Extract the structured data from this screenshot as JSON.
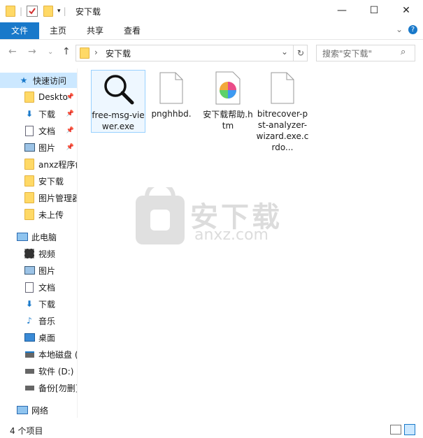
{
  "window": {
    "title": "安下载",
    "controls": {
      "minimize": "—",
      "maximize": "☐",
      "close": "✕"
    }
  },
  "ribbon": {
    "tabs": [
      "文件",
      "主页",
      "共享",
      "查看"
    ],
    "expand_glyph": "⌄",
    "help_glyph": "?"
  },
  "navbar": {
    "back": "←",
    "forward": "→",
    "recent": "⌄",
    "up": "↑",
    "address_sep": "›",
    "address": "安下载",
    "dropdown": "⌄",
    "refresh": "↻",
    "search_placeholder": "搜索\"安下载\"",
    "search_icon": "⌕"
  },
  "sidebar": {
    "quick_access": "快速访问",
    "quick_items": [
      "Deskto",
      "下载",
      "文档",
      "图片",
      "anxz程序创",
      "安下载",
      "图片管理器",
      "未上传"
    ],
    "this_pc": "此电脑",
    "pc_items": [
      "视频",
      "图片",
      "文档",
      "下载",
      "音乐",
      "桌面",
      "本地磁盘 (",
      "软件 (D:)",
      "备份[勿删]"
    ],
    "network": "网络"
  },
  "files": [
    {
      "name": "free-msg-viewer.exe",
      "icon": "magnifier-icon"
    },
    {
      "name": "pnghhbd.",
      "icon": "blank-file-icon"
    },
    {
      "name": "安下载帮助.htm",
      "icon": "color-wheel-icon"
    },
    {
      "name": "bitrecover-pst-analyzer-wizard.exe.crdo...",
      "icon": "blank-file-icon"
    }
  ],
  "status": {
    "count": "4 个项目"
  },
  "watermark": {
    "brand": "安下载",
    "domain": "anxz.com"
  },
  "colors": {
    "accent": "#1979ca",
    "selection": "#cce8ff",
    "folder": "#ffd966"
  }
}
